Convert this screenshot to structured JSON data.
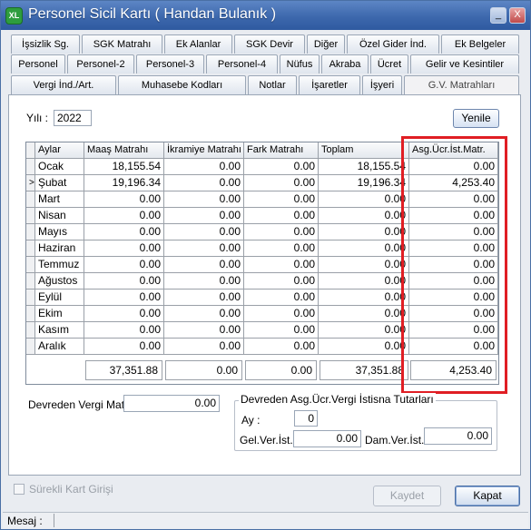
{
  "window": {
    "title": "Personel Sicil Kartı ( Handan Bulanık )",
    "icon": "XL",
    "minimize": "_",
    "close": "X"
  },
  "tabs": {
    "row1": [
      "İşsizlik Sg.",
      "SGK Matrahı",
      "Ek Alanlar",
      "SGK Devir",
      "Diğer",
      "Özel Gider İnd.",
      "Ek Belgeler"
    ],
    "row2": [
      "Personel",
      "Personel-2",
      "Personel-3",
      "Personel-4",
      "Nüfus",
      "Akraba",
      "Ücret",
      "Gelir ve Kesintiler"
    ],
    "row3": [
      "Vergi İnd./Art.",
      "Muhasebe Kodları",
      "Notlar",
      "İşaretler",
      "İşyeri",
      "G.V. Matrahları"
    ],
    "active": "G.V. Matrahları"
  },
  "form": {
    "year_label": "Yılı :",
    "year_value": "2022",
    "refresh_label": "Yenile"
  },
  "grid": {
    "columns": [
      "Aylar",
      "Maaş Matrahı",
      "İkramiye Matrahı",
      "Fark Matrahı",
      "Toplam",
      "Asg.Ücr.İst.Matr."
    ],
    "current_row_marker": ">",
    "rows": [
      [
        "Ocak",
        "18,155.54",
        "0.00",
        "0.00",
        "18,155.54",
        "0.00"
      ],
      [
        "Şubat",
        "19,196.34",
        "0.00",
        "0.00",
        "19,196.34",
        "4,253.40"
      ],
      [
        "Mart",
        "0.00",
        "0.00",
        "0.00",
        "0.00",
        "0.00"
      ],
      [
        "Nisan",
        "0.00",
        "0.00",
        "0.00",
        "0.00",
        "0.00"
      ],
      [
        "Mayıs",
        "0.00",
        "0.00",
        "0.00",
        "0.00",
        "0.00"
      ],
      [
        "Haziran",
        "0.00",
        "0.00",
        "0.00",
        "0.00",
        "0.00"
      ],
      [
        "Temmuz",
        "0.00",
        "0.00",
        "0.00",
        "0.00",
        "0.00"
      ],
      [
        "Ağustos",
        "0.00",
        "0.00",
        "0.00",
        "0.00",
        "0.00"
      ],
      [
        "Eylül",
        "0.00",
        "0.00",
        "0.00",
        "0.00",
        "0.00"
      ],
      [
        "Ekim",
        "0.00",
        "0.00",
        "0.00",
        "0.00",
        "0.00"
      ],
      [
        "Kasım",
        "0.00",
        "0.00",
        "0.00",
        "0.00",
        "0.00"
      ],
      [
        "Aralık",
        "0.00",
        "0.00",
        "0.00",
        "0.00",
        "0.00"
      ]
    ],
    "totals": [
      "37,351.88",
      "0.00",
      "0.00",
      "37,351.88",
      "4,253.40"
    ]
  },
  "carryover": {
    "label": "Devreden Vergi Mat:",
    "value": "0.00",
    "group_title": "Devreden Asg.Ücr.Vergi İstisna Tutarları",
    "month_label": "Ay :",
    "month_value": "0",
    "income_label": "Gel.Ver.İst.:",
    "income_value": "0.00",
    "stamp_label": "Dam.Ver.İst.:",
    "stamp_value": "0.00"
  },
  "footer": {
    "continuous_entry_label": "Sürekli Kart Girişi",
    "save_label": "Kaydet",
    "close_label": "Kapat",
    "status_label": "Mesaj :"
  },
  "colors": {
    "title_bar": "#3d68ad",
    "highlight": "#e01e24"
  }
}
